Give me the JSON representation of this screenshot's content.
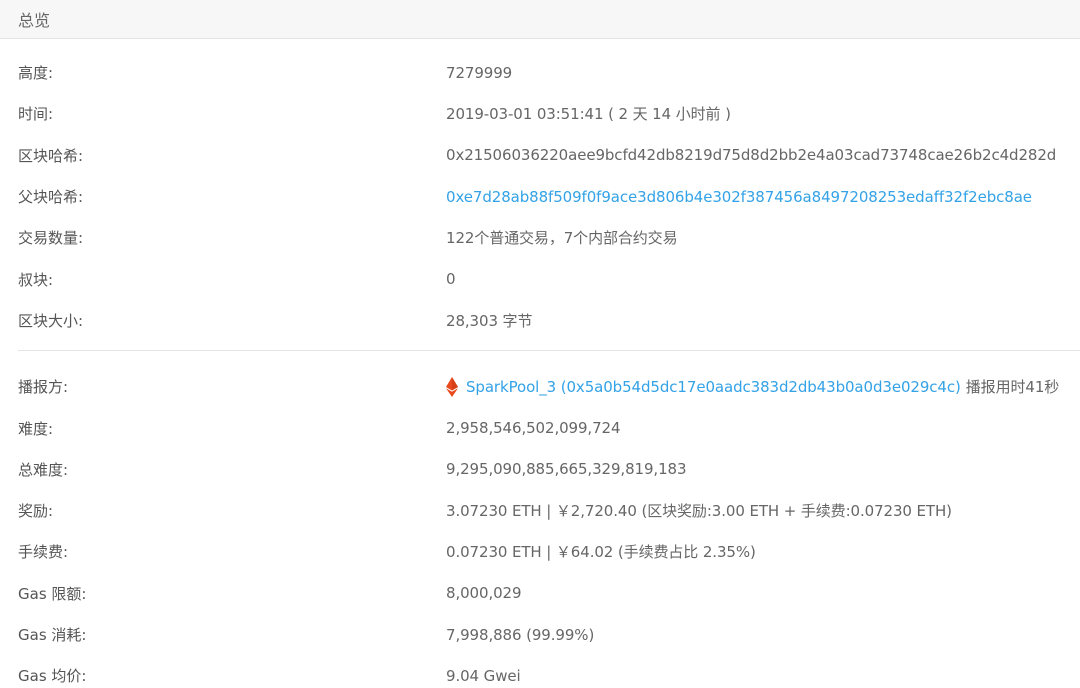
{
  "header": {
    "title": "总览"
  },
  "colors": {
    "link": "#33a2e6",
    "miner_icon": "#e8491d"
  },
  "rows_top": [
    {
      "label": "高度:",
      "value": "7279999"
    },
    {
      "label": "时间:",
      "value": "2019-03-01 03:51:41 ( 2 天 14 小时前 )"
    },
    {
      "label": "区块哈希:",
      "value": "0x21506036220aee9bcfd42db8219d75d8d2bb2e4a03cad73748cae26b2c4d282d"
    },
    {
      "label": "父块哈希:",
      "value": "0xe7d28ab88f509f0f9ace3d806b4e302f387456a8497208253edaff32f2ebc8ae"
    },
    {
      "label": "交易数量:",
      "value": "122个普通交易，7个内部合约交易"
    },
    {
      "label": "叔块:",
      "value": "0"
    },
    {
      "label": "区块大小:",
      "value": "28,303 字节"
    }
  ],
  "miner": {
    "label": "播报方:",
    "icon": "eth-diamond-icon",
    "link_text": "SparkPool_3 (0x5a0b54d5dc17e0aadc383d2db43b0a0d3e029c4c)",
    "suffix": "播报用时41秒"
  },
  "rows_bottom": [
    {
      "label": "难度:",
      "value": "2,958,546,502,099,724"
    },
    {
      "label": "总难度:",
      "value": "9,295,090,885,665,329,819,183"
    },
    {
      "label": "奖励:",
      "value": "3.07230 ETH | ￥2,720.40 (区块奖励:3.00 ETH + 手续费:0.07230 ETH)"
    },
    {
      "label": "手续费:",
      "value": "0.07230 ETH | ￥64.02 (手续费占比 2.35%)"
    },
    {
      "label": "Gas 限额:",
      "value": "8,000,029"
    },
    {
      "label": "Gas 消耗:",
      "value": "7,998,886 (99.99%)"
    },
    {
      "label": "Gas 均价:",
      "value": "9.04 Gwei"
    }
  ]
}
